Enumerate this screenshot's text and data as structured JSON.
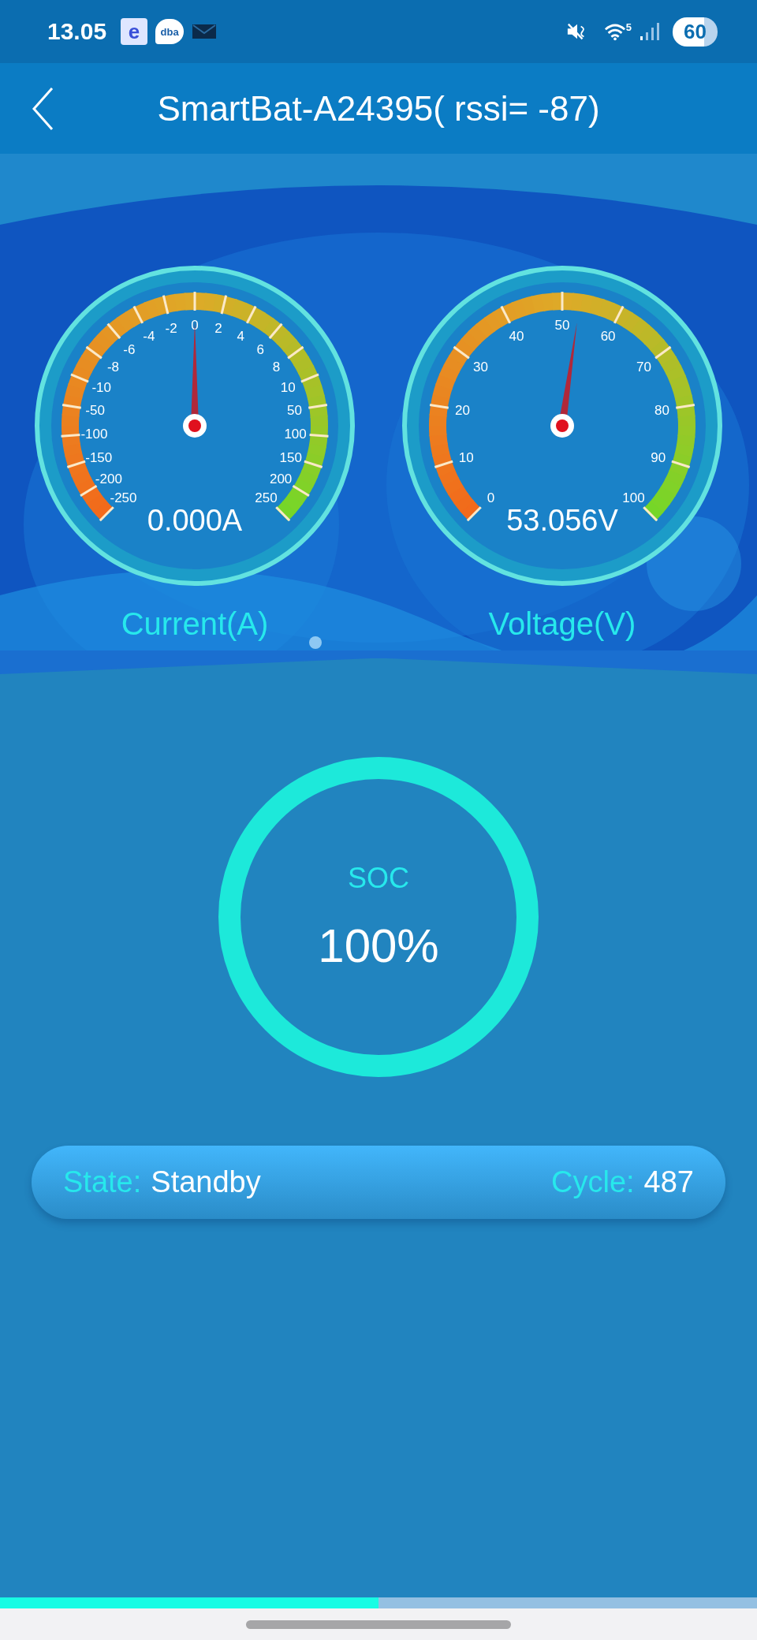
{
  "status_bar": {
    "time": "13.05",
    "notifications": [
      {
        "kind": "app",
        "text": "e"
      },
      {
        "kind": "chat",
        "text": "dba"
      },
      {
        "kind": "mail"
      }
    ],
    "wifi_band": "5",
    "battery": "60"
  },
  "header": {
    "title": "SmartBat-A24395( rssi= -87)"
  },
  "gauges": [
    {
      "label": "Current(A)",
      "value": "0.000A",
      "right_ticks": [
        "0",
        "2",
        "4",
        "6",
        "8",
        "10",
        "50",
        "100",
        "150",
        "200",
        "250"
      ],
      "left_ticks": [
        "-2",
        "-4",
        "-6",
        "-8",
        "-10",
        "-50",
        "-100",
        "-150",
        "-200",
        "-250"
      ]
    },
    {
      "label": "Voltage(V)",
      "value": "53.056V",
      "right_ticks": [
        "50",
        "60",
        "70",
        "80",
        "90",
        "100"
      ],
      "left_ticks": [
        "40",
        "30",
        "20",
        "10",
        "0"
      ]
    }
  ],
  "soc": {
    "label": "SOC",
    "value": "100%",
    "level": 1
  },
  "status": {
    "state_label": "State:",
    "state": "Standby",
    "cycle_label": "Cycle:",
    "cycle": "487"
  },
  "pager": [
    {
      "selected": true
    },
    {
      "selected": false
    }
  ]
}
